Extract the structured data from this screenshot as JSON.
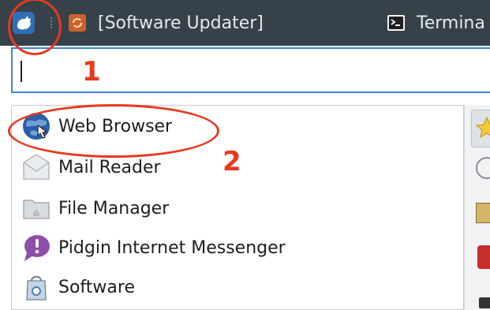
{
  "taskbar": {
    "tasks": [
      {
        "label": "[Software Updater]"
      },
      {
        "label": "Termina"
      }
    ]
  },
  "search": {
    "value": ""
  },
  "apps": [
    {
      "label": "Web Browser",
      "icon": "globe-icon"
    },
    {
      "label": "Mail Reader",
      "icon": "mail-icon"
    },
    {
      "label": "File Manager",
      "icon": "folder-icon"
    },
    {
      "label": "Pidgin Internet Messenger",
      "icon": "pidgin-icon"
    },
    {
      "label": "Software",
      "icon": "software-icon"
    }
  ],
  "annotations": {
    "step1": "1",
    "step2": "2"
  },
  "colors": {
    "annotation": "#e8391e",
    "taskbar": "#37414a",
    "focus": "#3a86d6"
  }
}
